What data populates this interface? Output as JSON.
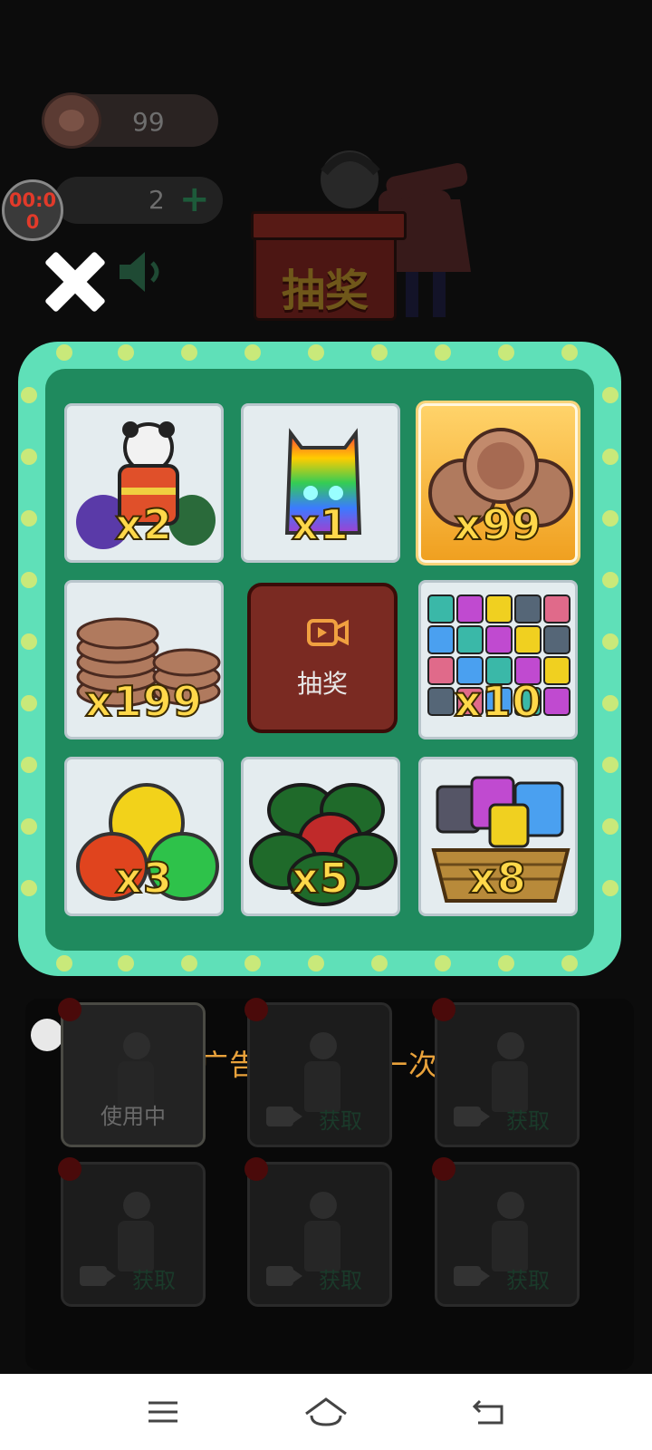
{
  "hud": {
    "coins": "99",
    "lives": "2",
    "timer": "00:00"
  },
  "lottery": {
    "title": "抽奖"
  },
  "prizes": [
    {
      "name": "panda-vest-bags",
      "qty": "x2",
      "selected": false
    },
    {
      "name": "rainbow-cat-block",
      "qty": "x1",
      "selected": false
    },
    {
      "name": "coins",
      "qty": "x99",
      "selected": true
    },
    {
      "name": "coin-stacks",
      "qty": "x199",
      "selected": false
    },
    {
      "name": "cat-blocks",
      "qty": "x10",
      "selected": false
    },
    {
      "name": "color-bags",
      "qty": "x3",
      "selected": false
    },
    {
      "name": "green-bags",
      "qty": "x5",
      "selected": false
    },
    {
      "name": "cat-basket",
      "qty": "x8",
      "selected": false
    }
  ],
  "center_button": {
    "label": "抽奖"
  },
  "ad_hint": "观看视频广告免费抽奖一次呦~",
  "characters": [
    {
      "status": "使用中"
    },
    {
      "status": "获取"
    },
    {
      "status": "获取"
    },
    {
      "status": "获取"
    },
    {
      "status": "获取"
    },
    {
      "status": "获取"
    }
  ],
  "colors": {
    "panel_outer": "#5fe0b8",
    "panel_inner": "#1f8a5e",
    "accent_gold": "#ffd84a",
    "hint": "#e9a23b"
  }
}
